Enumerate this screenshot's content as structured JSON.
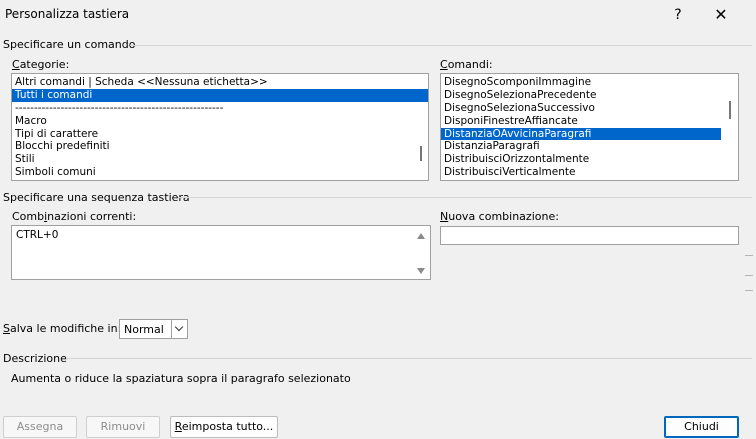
{
  "window": {
    "title": "Personalizza tastiera",
    "help": "?",
    "close": "✕"
  },
  "command_section": {
    "label": "Specificare un comando",
    "categories": {
      "label_u": "C",
      "label_rest": "ategorie:",
      "items": [
        "Altri comandi | Scheda <<Nessuna etichetta>>",
        "Tutti i comandi",
        "-------------------------------------------------------",
        "Macro",
        "Tipi di carattere",
        "Blocchi predefiniti",
        "Stili",
        "Simboli comuni"
      ],
      "selected_index": 1
    },
    "commands": {
      "label_u": "C",
      "label_rest": "omandi:",
      "items": [
        "DisegnoScomponiImmagine",
        "DisegnoSelezionaPrecedente",
        "DisegnoSelezionaSuccessivo",
        "DisponiFinestreAffiancate",
        "DistanziaOAvvicinaParagrafi",
        "DistanziaParagrafi",
        "DistribuisciOrizzontalmente",
        "DistribuisciVerticalmente"
      ],
      "selected_index": 4
    }
  },
  "key_section": {
    "label": "Specificare una sequenza tastiera",
    "current": {
      "label_pre": "Comb",
      "label_u": "i",
      "label_rest": "nazioni correnti:",
      "items": [
        "CTRL+0"
      ]
    },
    "new": {
      "label_u": "N",
      "label_rest": "uova combinazione:",
      "value": ""
    }
  },
  "save": {
    "label_u": "S",
    "label_rest": "alva le modifiche in:",
    "value": "Normal"
  },
  "description": {
    "label": "Descrizione",
    "text": "Aumenta o riduce la spaziatura sopra il paragrafo selezionato"
  },
  "buttons": {
    "assign": "Assegna",
    "remove": "Rimuovi",
    "reset_u": "R",
    "reset_rest": "eimposta tutto...",
    "close": "Chiudi"
  }
}
